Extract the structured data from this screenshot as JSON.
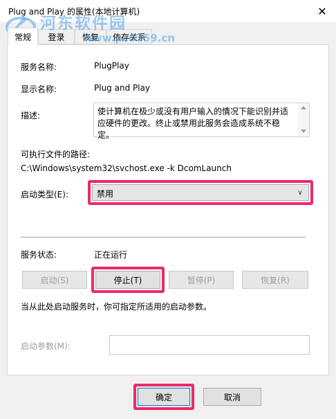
{
  "window": {
    "title": "Plug and Play 的属性(本地计算机)"
  },
  "watermark": {
    "line1": "河东软件园",
    "line2": "www.pc0359.cn"
  },
  "tabs": [
    {
      "label": "常规"
    },
    {
      "label": "登录"
    },
    {
      "label": "恢复"
    },
    {
      "label": "依存关系"
    }
  ],
  "general": {
    "service_name_label": "服务名称:",
    "service_name": "PlugPlay",
    "display_name_label": "显示名称:",
    "display_name": "Plug and Play",
    "description_label": "描述:",
    "description": "使计算机在极少或没有用户输入的情况下能识别并适应硬件的更改。终止或禁用此服务会造成系统不稳定。",
    "path_label": "可执行文件的路径:",
    "path": "C:\\Windows\\system32\\svchost.exe -k DcomLaunch",
    "startup_type_label": "启动类型(E):",
    "startup_type": "禁用",
    "status_label": "服务状态:",
    "status": "正在运行",
    "start_button": "启动(S)",
    "stop_button": "停止(T)",
    "pause_button": "暂停(P)",
    "resume_button": "恢复(R)",
    "hint": "当从此处启动服务时，你可指定所适用的启动参数。",
    "params_label": "启动参数(M):",
    "params_value": ""
  },
  "footer": {
    "ok_button": "确定",
    "cancel_button": "取消"
  },
  "colors": {
    "highlight": "#ec2a6a",
    "primary_border": "#0078d7"
  }
}
